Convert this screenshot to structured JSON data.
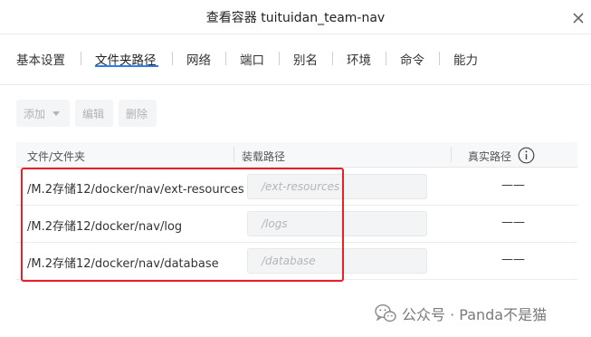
{
  "window": {
    "title": "查看容器 tuituidan_team-nav"
  },
  "tabs": [
    {
      "label": "基本设置"
    },
    {
      "label": "文件夹路径"
    },
    {
      "label": "网络"
    },
    {
      "label": "端口"
    },
    {
      "label": "别名"
    },
    {
      "label": "环境"
    },
    {
      "label": "命令"
    },
    {
      "label": "能力"
    }
  ],
  "active_tab": "文件夹路径",
  "toolbar": {
    "add_label": "添加",
    "edit_label": "编辑",
    "delete_label": "删除"
  },
  "table": {
    "columns": [
      "文件/文件夹",
      "装载路径",
      "真实路径"
    ],
    "rows": [
      {
        "path": "/M.2存储12/docker/nav/ext-resources",
        "mount": "/ext-resources",
        "real": "——"
      },
      {
        "path": "/M.2存储12/docker/nav/log",
        "mount": "/logs",
        "real": "——"
      },
      {
        "path": "/M.2存储12/docker/nav/database",
        "mount": "/database",
        "real": "——"
      }
    ]
  },
  "watermark": {
    "text": "公众号 · Panda不是猫"
  },
  "colors": {
    "accent": "#2c7cf6",
    "highlight": "#e8202a",
    "disabled_text": "#b3b3b3"
  },
  "icons": [
    "close-icon",
    "dropdown-caret-icon",
    "info-icon",
    "wechat-icon"
  ]
}
